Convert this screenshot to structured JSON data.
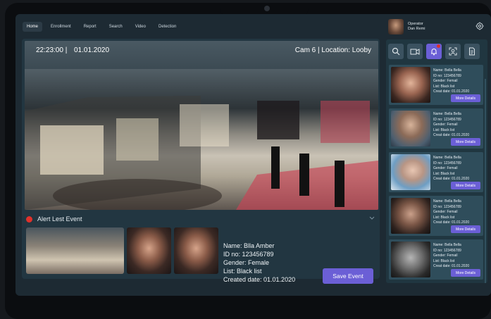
{
  "nav": {
    "items": [
      {
        "label": "Home",
        "active": true
      },
      {
        "label": "Enrollment",
        "active": false
      },
      {
        "label": "Report",
        "active": false
      },
      {
        "label": "Search",
        "active": false
      },
      {
        "label": "Video",
        "active": false
      },
      {
        "label": "Detection",
        "active": false
      }
    ]
  },
  "operator": {
    "role": "Operator",
    "name": "Dan Remi"
  },
  "video": {
    "timestamp": "22:23:00 |",
    "date": "01.01.2020",
    "camera_location": "Cam 6 | Location: Looby"
  },
  "alert": {
    "title": "Alert Lest Event",
    "name": "Name: Blla Amber",
    "id": "ID no: 123456789",
    "gender": "Gender: Female",
    "list": "List: Black list",
    "created": "Created date: 01.01.2020",
    "save_label": "Save Event"
  },
  "toolbar": {
    "icons": [
      "search-icon",
      "camera-icon",
      "bell-icon",
      "face-scan-icon",
      "document-icon"
    ],
    "active_index": 2,
    "notification_color": "#e0312b"
  },
  "cards": [
    {
      "name": "Name: Bella Bella",
      "id": "ID no: 123456789",
      "gender": "Gender: Femail",
      "list": "List: Black list",
      "created": "Creat date: 01.01.2020",
      "button": "More Details"
    },
    {
      "name": "Name: Bella Bella",
      "id": "ID no: 123456789",
      "gender": "Gender: Femail",
      "list": "List: Black list",
      "created": "Creat date: 01.01.2020",
      "button": "More Details"
    },
    {
      "name": "Name: Bella Bella",
      "id": "ID no: 123456789",
      "gender": "Gender: Femail",
      "list": "List: Black list",
      "created": "Creat date: 01.01.2020",
      "button": "More Details"
    },
    {
      "name": "Name: Bella Bella",
      "id": "ID no: 123456789",
      "gender": "Gender: Femail",
      "list": "List: Black list",
      "created": "Creat date: 01.01.2020",
      "button": "More Details"
    },
    {
      "name": "Name: Bella Bella",
      "id": "ID no: 123456789",
      "gender": "Gender: Femail",
      "list": "List: Black list",
      "created": "Creat date: 01.01.2020",
      "button": "More Details"
    }
  ],
  "colors": {
    "accent": "#6b5fd6",
    "panel": "#223641",
    "alert": "#e0312b"
  }
}
